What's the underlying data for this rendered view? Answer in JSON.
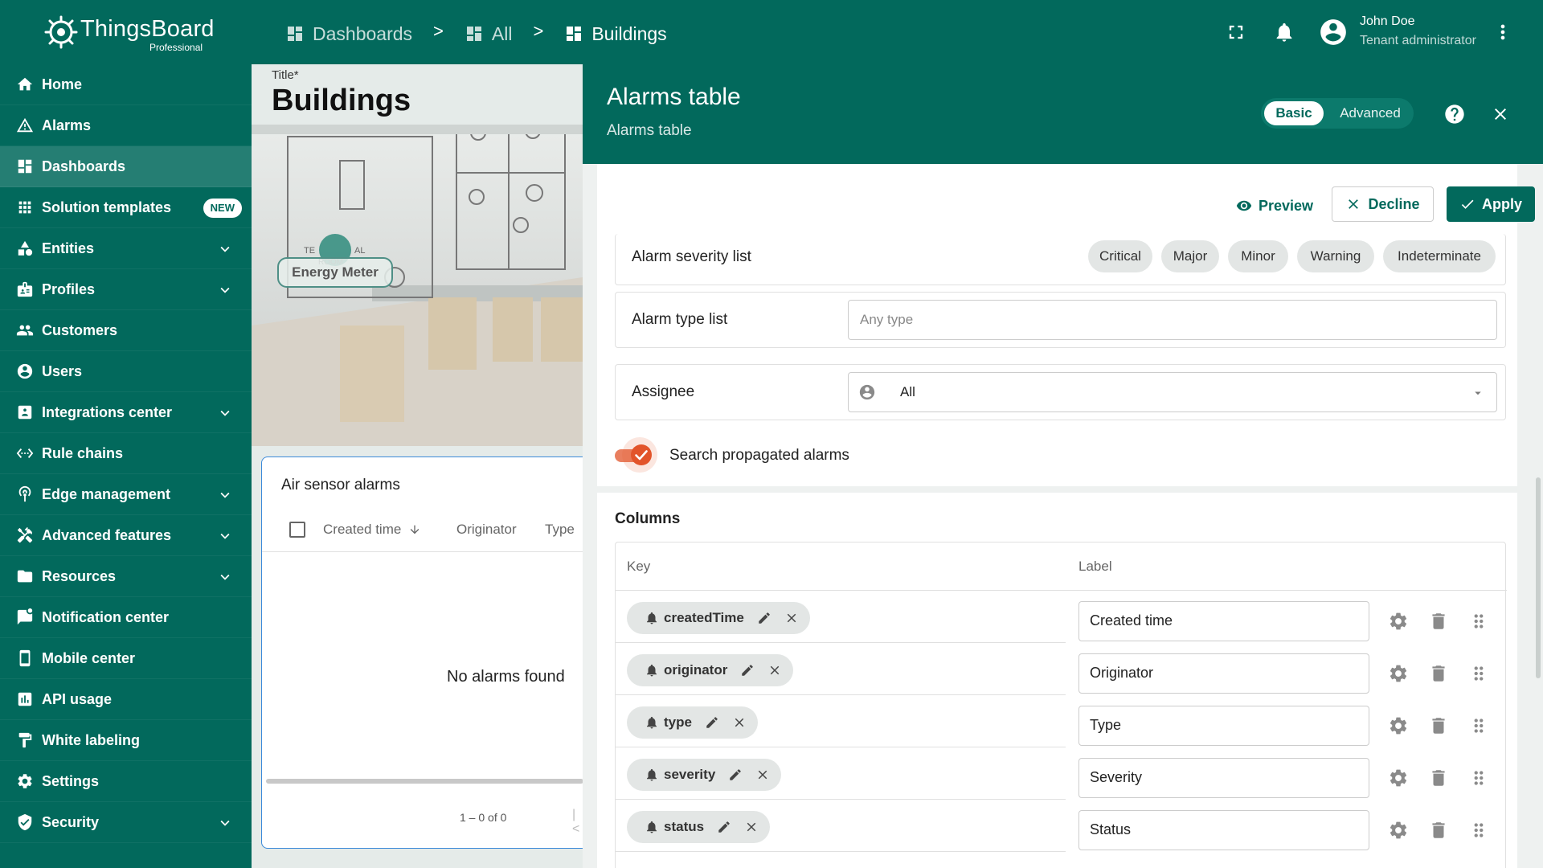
{
  "app": {
    "logo_title": "ThingsBoard",
    "logo_subtitle": "Professional",
    "breadcrumbs": [
      "Dashboards",
      "All",
      "Buildings"
    ],
    "breadcrumb_separator": ">",
    "user_name": "John Doe",
    "user_role": "Tenant administrator"
  },
  "sidebar": {
    "items": [
      {
        "label": "Home",
        "icon": "home-icon"
      },
      {
        "label": "Alarms",
        "icon": "warning-icon"
      },
      {
        "label": "Dashboards",
        "icon": "dashboard-icon",
        "active": true
      },
      {
        "label": "Solution templates",
        "icon": "apps-icon",
        "badge": "NEW"
      },
      {
        "label": "Entities",
        "icon": "entities-icon",
        "expandable": true
      },
      {
        "label": "Profiles",
        "icon": "profiles-icon",
        "expandable": true
      },
      {
        "label": "Customers",
        "icon": "customers-icon"
      },
      {
        "label": "Users",
        "icon": "user-icon"
      },
      {
        "label": "Integrations center",
        "icon": "integrations-icon",
        "expandable": true
      },
      {
        "label": "Rule chains",
        "icon": "rule-chains-icon"
      },
      {
        "label": "Edge management",
        "icon": "edge-icon",
        "expandable": true
      },
      {
        "label": "Advanced features",
        "icon": "tools-icon",
        "expandable": true
      },
      {
        "label": "Resources",
        "icon": "folder-icon",
        "expandable": true
      },
      {
        "label": "Notification center",
        "icon": "notification-icon"
      },
      {
        "label": "Mobile center",
        "icon": "mobile-icon"
      },
      {
        "label": "API usage",
        "icon": "api-usage-icon"
      },
      {
        "label": "White labeling",
        "icon": "paint-icon"
      },
      {
        "label": "Settings",
        "icon": "gear-icon"
      },
      {
        "label": "Security",
        "icon": "shield-icon",
        "expandable": true
      }
    ]
  },
  "dashboard": {
    "title_label": "Title*",
    "title": "Buildings",
    "energy_meter_label": "Energy Meter",
    "air_widget": {
      "title": "Air sensor alarms",
      "columns": [
        "Created time",
        "Originator",
        "Type"
      ],
      "empty_text": "No alarms found",
      "pagination": "1 – 0 of 0"
    }
  },
  "panel": {
    "title": "Alarms table",
    "subtitle": "Alarms table",
    "mode_basic": "Basic",
    "mode_advanced": "Advanced",
    "preview_label": "Preview",
    "decline_label": "Decline",
    "apply_label": "Apply",
    "severity_label": "Alarm severity list",
    "severities": [
      "Critical",
      "Major",
      "Minor",
      "Warning",
      "Indeterminate"
    ],
    "type_label": "Alarm type list",
    "type_placeholder": "Any type",
    "assignee_label": "Assignee",
    "assignee_value": "All",
    "search_propagated_label": "Search propagated alarms",
    "search_propagated_on": true,
    "columns_title": "Columns",
    "columns_key_header": "Key",
    "columns_label_header": "Label",
    "columns": [
      {
        "key": "createdTime",
        "label": "Created time"
      },
      {
        "key": "originator",
        "label": "Originator"
      },
      {
        "key": "type",
        "label": "Type"
      },
      {
        "key": "severity",
        "label": "Severity"
      },
      {
        "key": "status",
        "label": "Status"
      }
    ]
  },
  "colors": {
    "primary": "#02695c",
    "toggle_accent": "#e2542a",
    "chip_bg": "#e3e6e5"
  }
}
